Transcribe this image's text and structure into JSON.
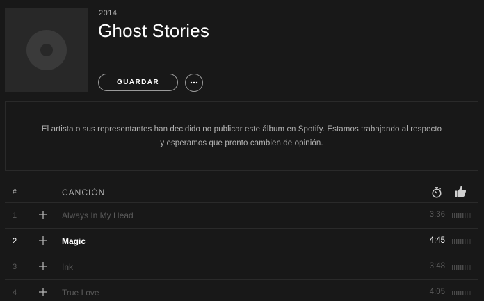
{
  "album": {
    "year": "2014",
    "title": "Ghost Stories",
    "art_icon": "vinyl-record-icon"
  },
  "actions": {
    "save_label": "GUARDAR",
    "more_icon": "more-options-icon"
  },
  "notice": {
    "text": "El artista o sus representantes han decidido no publicar este álbum en Spotify. Estamos trabajando al respecto y esperamos que pronto cambien de opinión."
  },
  "tracklist": {
    "headers": {
      "number": "#",
      "song": "CANCIÓN",
      "duration_icon": "stopwatch-icon",
      "popularity_icon": "thumbs-up-icon"
    },
    "tracks": [
      {
        "number": "1",
        "name": "Always In My Head",
        "duration": "3:36",
        "available": false
      },
      {
        "number": "2",
        "name": "Magic",
        "duration": "4:45",
        "available": true
      },
      {
        "number": "3",
        "name": "Ink",
        "duration": "3:48",
        "available": false
      },
      {
        "number": "4",
        "name": "True Love",
        "duration": "4:05",
        "available": false
      }
    ]
  },
  "colors": {
    "background": "#181818",
    "text_primary": "#ffffff",
    "text_secondary": "#b3b3b3",
    "text_disabled": "#5a5a5a",
    "border": "#2a2a2a"
  }
}
